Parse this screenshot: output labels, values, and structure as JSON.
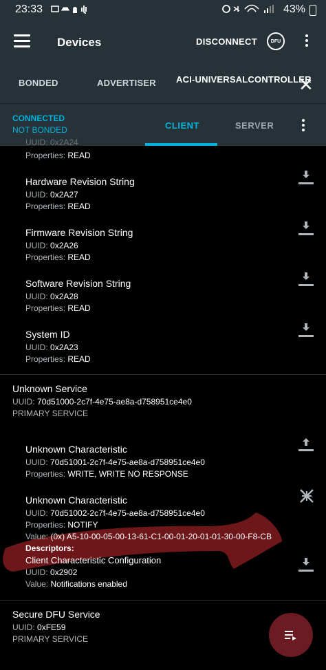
{
  "status_bar": {
    "time": "23:33",
    "battery_pct": "43%"
  },
  "app_bar": {
    "title": "Devices",
    "disconnect": "DISCONNECT",
    "dfu": "DFU"
  },
  "tabs": {
    "bonded": "BONDED",
    "advertiser": "ADVERTISER",
    "device": "ACI-UNIVERSALCONTROLLER"
  },
  "connection": {
    "connected": "CONNECTED",
    "not_bonded": "NOT BONDED",
    "client": "CLIENT",
    "server": "SERVER"
  },
  "top_partial": {
    "properties_label": "Properties:",
    "properties": "READ"
  },
  "characteristics1": [
    {
      "name": "Hardware Revision String",
      "uuid_label": "UUID:",
      "uuid": "0x2A27",
      "properties_label": "Properties:",
      "properties": "READ"
    },
    {
      "name": "Firmware Revision String",
      "uuid_label": "UUID:",
      "uuid": "0x2A26",
      "properties_label": "Properties:",
      "properties": "READ"
    },
    {
      "name": "Software Revision String",
      "uuid_label": "UUID:",
      "uuid": "0x2A28",
      "properties_label": "Properties:",
      "properties": "READ"
    },
    {
      "name": "System ID",
      "uuid_label": "UUID:",
      "uuid": "0x2A23",
      "properties_label": "Properties:",
      "properties": "READ"
    }
  ],
  "service2": {
    "name": "Unknown Service",
    "uuid_label": "UUID:",
    "uuid": "70d51000-2c7f-4e75-ae8a-d758951ce4e0",
    "type": "PRIMARY SERVICE"
  },
  "char_write": {
    "name": "Unknown Characteristic",
    "uuid_label": "UUID:",
    "uuid": "70d51001-2c7f-4e75-ae8a-d758951ce4e0",
    "properties_label": "Properties:",
    "properties": "WRITE, WRITE NO RESPONSE"
  },
  "char_notify": {
    "name": "Unknown Characteristic",
    "uuid_label": "UUID:",
    "uuid": "70d51002-2c7f-4e75-ae8a-d758951ce4e0",
    "properties_label": "Properties:",
    "properties": "NOTIFY",
    "value_label": "Value:",
    "value": "(0x) A5-10-00-05-00-13-61-C1-00-01-20-01-01-30-00-F8-CB",
    "descriptors_label": "Descriptors:",
    "descriptor": {
      "name": "Client Characteristic Configuration",
      "uuid_label": "UUID:",
      "uuid": "0x2902",
      "value_label": "Value:",
      "value": "Notifications enabled"
    }
  },
  "service3": {
    "name": "Secure DFU Service",
    "uuid_label": "UUID:",
    "uuid": "0xFE59",
    "type": "PRIMARY SERVICE"
  },
  "colors": {
    "accent": "#00b3dc",
    "bar": "#263238",
    "fab": "#6d1b22",
    "scribble": "#7a1a1e"
  }
}
